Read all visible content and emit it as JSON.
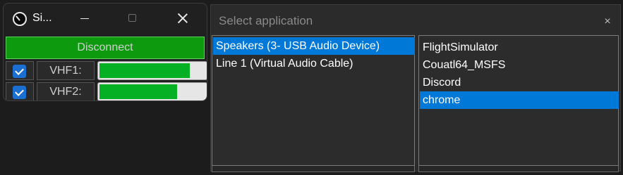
{
  "app_window": {
    "title": "Si...",
    "disconnect_label": "Disconnect",
    "channels": [
      {
        "label": "VHF1:",
        "checked": true,
        "level": 0.85
      },
      {
        "label": "VHF2:",
        "checked": true,
        "level": 0.73
      }
    ]
  },
  "select_dialog": {
    "title": "Select application",
    "close_label": "×",
    "devices": [
      {
        "label": "Speakers (3- USB Audio Device)",
        "selected": true
      },
      {
        "label": "Line 1 (Virtual Audio Cable)",
        "selected": false
      }
    ],
    "applications": [
      {
        "label": "FlightSimulator",
        "selected": false
      },
      {
        "label": "Couatl64_MSFS",
        "selected": false
      },
      {
        "label": "Discord",
        "selected": false
      },
      {
        "label": "chrome",
        "selected": true
      }
    ]
  },
  "colors": {
    "accent": "#0078d7",
    "level_green": "#06b025",
    "disconnect_green": "#0e9a0e"
  }
}
